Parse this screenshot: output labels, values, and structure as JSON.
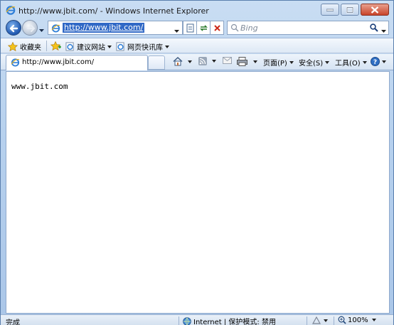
{
  "window": {
    "title": "http://www.jbit.com/ - Windows Internet Explorer"
  },
  "address_bar": {
    "url": "http://www.jbit.com/"
  },
  "search": {
    "placeholder": "Bing"
  },
  "favorites_bar": {
    "favorites_label": "收藏夹",
    "suggested_sites_label": "建议网站",
    "web_slice_label": "网页快讯库"
  },
  "tab": {
    "label": "http://www.jbit.com/"
  },
  "command_bar": {
    "page_label": "页面(P)",
    "safety_label": "安全(S)",
    "tools_label": "工具(O)"
  },
  "page": {
    "body_text": "www.jbit.com"
  },
  "status_bar": {
    "status_text": "完成",
    "zone_label": "Internet | 保护模式: 禁用",
    "zoom_level": "100%"
  },
  "colors": {
    "frame_blue": "#b7d1ee",
    "selection_blue": "#3169c6",
    "close_red": "#c8442a"
  },
  "icons": [
    "ie-logo-icon",
    "minimize-icon",
    "restore-icon",
    "close-icon",
    "back-icon",
    "forward-icon",
    "chevron-down-icon",
    "compatibility-view-icon",
    "refresh-icon",
    "stop-icon",
    "search-icon",
    "favorites-star-icon",
    "add-favorites-icon",
    "home-icon",
    "rss-icon",
    "mail-icon",
    "print-icon",
    "help-icon",
    "globe-icon",
    "zoom-icon"
  ]
}
